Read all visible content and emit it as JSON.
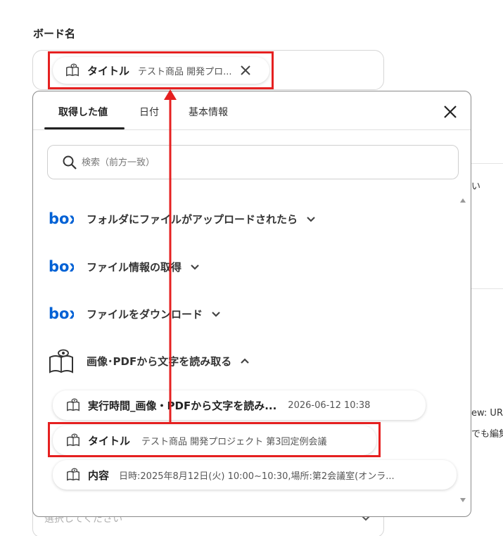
{
  "board": {
    "label": "ボード名"
  },
  "selected_chip": {
    "title": "タイトル",
    "value": "テスト商品 開発プロ..."
  },
  "popup": {
    "tabs": [
      {
        "label": "取得した値",
        "active": true
      },
      {
        "label": "日付",
        "active": false
      },
      {
        "label": "基本情報",
        "active": false
      }
    ],
    "search": {
      "placeholder": "検索（前方一致）",
      "value": ""
    },
    "sections": [
      {
        "title": "フォルダにファイルがアップロードされたら",
        "icon": "box-logo",
        "expanded": false
      },
      {
        "title": "ファイル情報の取得",
        "icon": "box-logo",
        "expanded": false
      },
      {
        "title": "ファイルをダウンロード",
        "icon": "box-logo",
        "expanded": false
      },
      {
        "title": "画像･PDFから文字を読み取る",
        "icon": "book-eye-icon",
        "expanded": true
      }
    ],
    "items": [
      {
        "title": "実行時間_画像・PDFから文字を読み...",
        "value": "2026-06-12 10:38"
      },
      {
        "title": "タイトル",
        "value": "テスト商品 開発プロジェクト 第3回定例会議"
      },
      {
        "title": "内容",
        "value": "日時:2025年8月12日(火) 10:00~10:30,場所:第2会議室(オンラ..."
      }
    ]
  },
  "background": {
    "frag_1": "い",
    "frag_2": "ew: UR",
    "frag_3": "でも編集",
    "bottom_select": "選択してください"
  },
  "colors": {
    "highlight": "#e52020",
    "box_blue": "#0061d5",
    "text": "#333333"
  }
}
